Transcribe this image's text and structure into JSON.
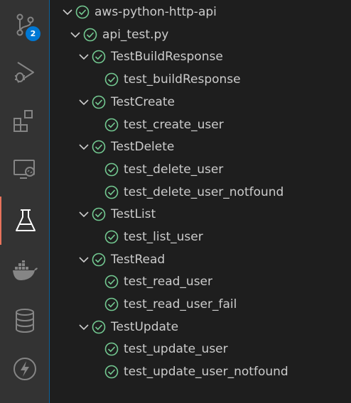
{
  "activity_bar": {
    "items": [
      {
        "name": "source-control",
        "badge": "2"
      },
      {
        "name": "run-and-debug"
      },
      {
        "name": "extensions"
      },
      {
        "name": "remote-explorer"
      },
      {
        "name": "testing",
        "active": true
      },
      {
        "name": "docker"
      },
      {
        "name": "database"
      },
      {
        "name": "lightning"
      }
    ]
  },
  "test_tree": {
    "root": {
      "label": "aws-python-http-api",
      "status": "passed"
    },
    "file": {
      "label": "api_test.py",
      "status": "passed"
    },
    "classes": [
      {
        "label": "TestBuildResponse",
        "tests": [
          "test_buildResponse"
        ]
      },
      {
        "label": "TestCreate",
        "tests": [
          "test_create_user"
        ]
      },
      {
        "label": "TestDelete",
        "tests": [
          "test_delete_user",
          "test_delete_user_notfound"
        ]
      },
      {
        "label": "TestList",
        "tests": [
          "test_list_user"
        ]
      },
      {
        "label": "TestRead",
        "tests": [
          "test_read_user",
          "test_read_user_fail"
        ]
      },
      {
        "label": "TestUpdate",
        "tests": [
          "test_update_user",
          "test_update_user_notfound"
        ]
      }
    ]
  },
  "colors": {
    "passed": "#73c991",
    "active_indicator": "#e8735c",
    "badge": "#0078d4",
    "icon": "#858585"
  }
}
